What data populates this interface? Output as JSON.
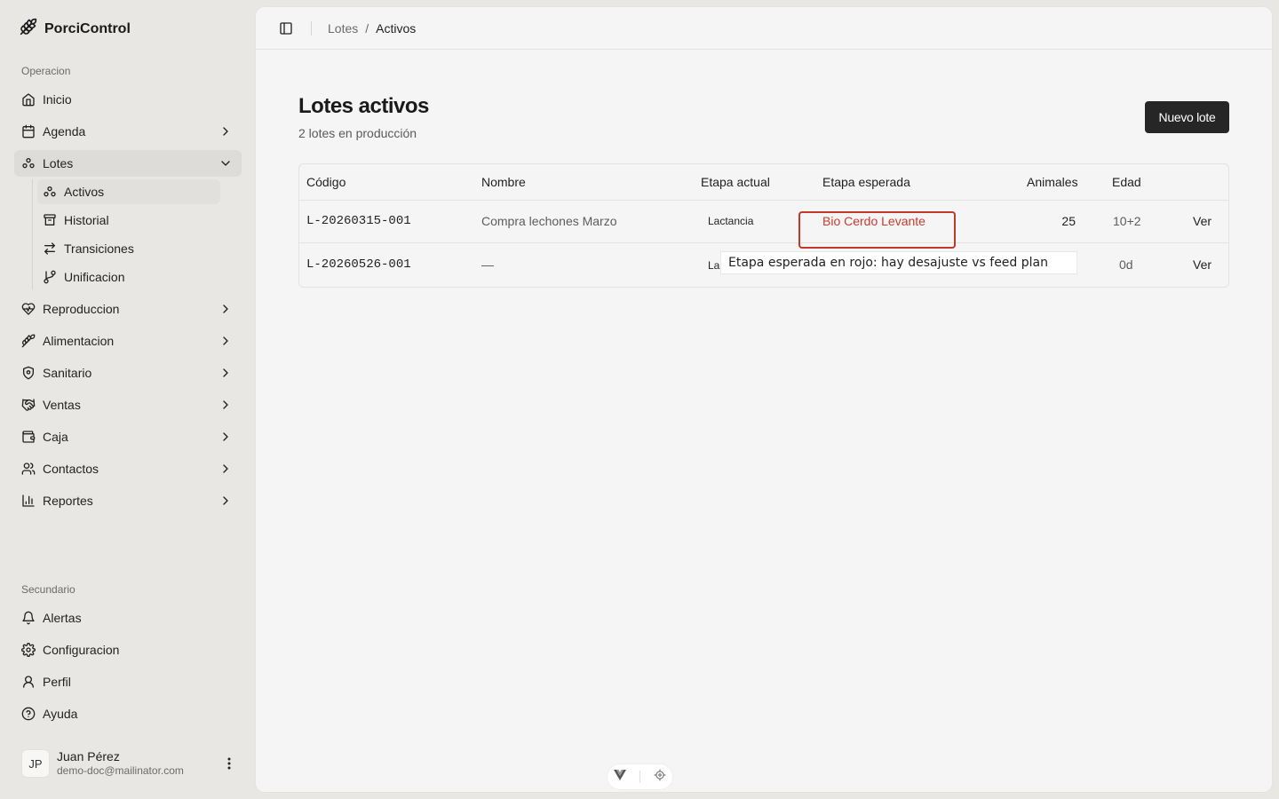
{
  "app": {
    "name": "PorciControl"
  },
  "sidebar": {
    "section_operacion": "Operacion",
    "items": [
      {
        "label": "Inicio",
        "icon": "home-icon"
      },
      {
        "label": "Agenda",
        "icon": "calendar-icon"
      },
      {
        "label": "Lotes",
        "icon": "lotes-icon"
      },
      {
        "label": "Reproduccion",
        "icon": "heart-pulse-icon"
      },
      {
        "label": "Alimentacion",
        "icon": "wheat-icon"
      },
      {
        "label": "Sanitario",
        "icon": "shield-icon"
      },
      {
        "label": "Ventas",
        "icon": "handshake-icon"
      },
      {
        "label": "Caja",
        "icon": "wallet-icon"
      },
      {
        "label": "Contactos",
        "icon": "users-icon"
      },
      {
        "label": "Reportes",
        "icon": "bar-chart-icon"
      }
    ],
    "lotes_sub": [
      {
        "label": "Activos",
        "icon": "lotes-icon"
      },
      {
        "label": "Historial",
        "icon": "archive-icon"
      },
      {
        "label": "Transiciones",
        "icon": "arrows-swap-icon"
      },
      {
        "label": "Unificacion",
        "icon": "route-icon"
      }
    ],
    "section_secundario": "Secundario",
    "secondary": [
      {
        "label": "Alertas",
        "icon": "bell-icon"
      },
      {
        "label": "Configuracion",
        "icon": "gear-icon"
      },
      {
        "label": "Perfil",
        "icon": "user-icon"
      },
      {
        "label": "Ayuda",
        "icon": "help-circle-icon"
      }
    ],
    "user": {
      "initials": "JP",
      "name": "Juan Pérez",
      "email": "demo-doc@mailinator.com"
    }
  },
  "breadcrumb": {
    "parent": "Lotes",
    "separator": "/",
    "current": "Activos"
  },
  "page": {
    "title": "Lotes activos",
    "subtitle": "2 lotes en producción",
    "new_button": "Nuevo lote"
  },
  "table": {
    "headers": {
      "codigo": "Código",
      "nombre": "Nombre",
      "etapa_actual": "Etapa actual",
      "etapa_esperada": "Etapa esperada",
      "animales": "Animales",
      "edad": "Edad"
    },
    "rows": [
      {
        "codigo": "L-20260315-001",
        "nombre": "Compra lechones Marzo",
        "etapa_actual": "Lactancia",
        "etapa_esperada": "Bio Cerdo Levante",
        "animales": "25",
        "edad": "10+2",
        "action": "Ver"
      },
      {
        "codigo": "L-20260526-001",
        "nombre": "—",
        "etapa_actual": "La",
        "etapa_esperada": "",
        "animales": "",
        "edad": "0d",
        "action": "Ver"
      }
    ]
  },
  "tooltip": {
    "text": "Etapa esperada en rojo: hay desajuste vs feed plan"
  },
  "colors": {
    "accent_dark": "#262626",
    "mismatch_red": "#cc3a2e",
    "highlight_border": "#c0392b"
  }
}
